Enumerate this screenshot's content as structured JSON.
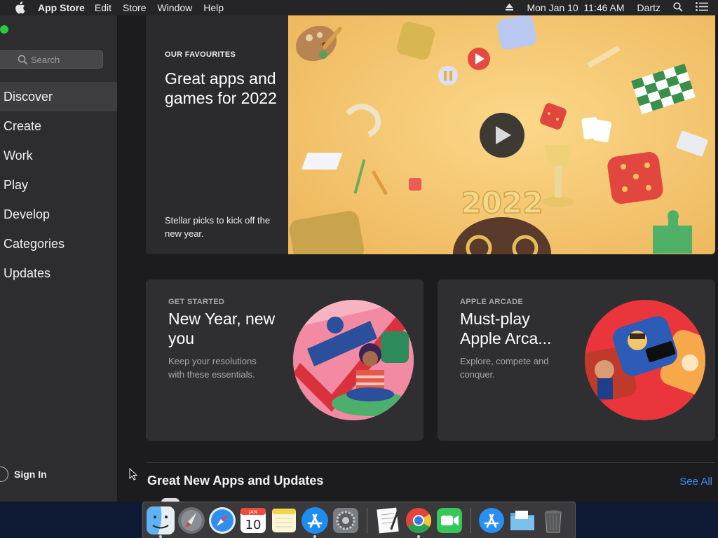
{
  "menubar": {
    "app_name": "App Store",
    "items": [
      "Edit",
      "Store",
      "Window",
      "Help"
    ],
    "datetime": "Mon Jan 10  11:46 AM",
    "user": "Dartz"
  },
  "sidebar": {
    "search_placeholder": "Search",
    "items": [
      {
        "label": "Discover"
      },
      {
        "label": "Create"
      },
      {
        "label": "Work"
      },
      {
        "label": "Play"
      },
      {
        "label": "Develop"
      },
      {
        "label": "Categories"
      },
      {
        "label": "Updates"
      }
    ],
    "active_index": 0,
    "sign_in_label": "Sign In"
  },
  "hero": {
    "eyebrow": "OUR FAVOURITES",
    "headline": "Great apps and games for 2022",
    "subtitle": "Stellar picks to kick off the new year.",
    "art_year": "2022"
  },
  "cards": [
    {
      "eyebrow": "GET STARTED",
      "title": "New Year, new you",
      "description": "Keep your resolutions with these essentials."
    },
    {
      "eyebrow": "APPLE ARCADE",
      "title": "Must-play Apple Arca...",
      "description": "Explore, compete and conquer."
    }
  ],
  "section": {
    "title": "Great New Apps and Updates",
    "see_all_label": "See All"
  },
  "dock": {
    "calendar_month": "JAN",
    "calendar_day": "10",
    "apps": [
      "finder",
      "launchpad",
      "safari",
      "calendar",
      "notes",
      "app-store",
      "system-preferences",
      "textedit",
      "chrome",
      "facetime",
      "app-store-folder",
      "documents-folder",
      "trash"
    ]
  },
  "colors": {
    "accent": "#3b8cf5",
    "sidebar_bg": "#2d2d2f",
    "card_bg": "#2f2f31",
    "hero_bg": "#f4c66a"
  }
}
